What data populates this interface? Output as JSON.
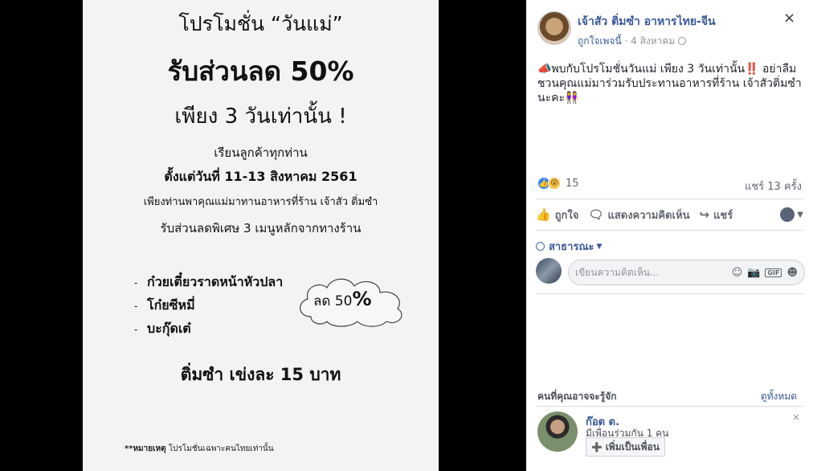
{
  "poster": {
    "promo_title": "โปรโมชั่น “วันแม่”",
    "discount_headline": "รับส่วนลด 50%",
    "only_days": "เพียง 3 วันเท่านั้น !",
    "dear_customers": "เรียนลูกค้าทุกท่าน",
    "date_range": "ตั้งแต่วันที่ 11-13 สิงหาคม 2561",
    "bring_mother": "เพียงท่านพาคุณแม่มาทานอาหารที่ร้าน เจ้าสัว ติ่มซำ",
    "special_discount": "รับส่วนลดพิเศษ 3 เมนูหลักจากทางร้าน",
    "menu_items": [
      "ก๋วยเตี๋ยวราดหน้าหัวปลา",
      "โก๋ยซีหมี่",
      "บะกุ๊ดเต๋"
    ],
    "menu_bullet": "-",
    "cloud_discount": "ลด 50",
    "cloud_percent": "%",
    "dimsum_price": "ติ่มซำ เข่งละ 15 บาท",
    "footnote_label": "**หมายเหตุ",
    "footnote_text": "โปรโมชั่นเฉพาะคนไทยเท่านั้น"
  },
  "post": {
    "page_name": "เจ้าสัว ติ่มซำ อาหารไทย-จีน",
    "like_page_link": "ถูกใจเพจนี้",
    "separator": " · ",
    "date": "4 สิงหาคม",
    "close_icon": "×",
    "text": "📣พบกับโปรโมชั่นวันแม่ เพียง 3 วันเท่านั้น‼️ อย่าลืมชวนคุณแม่มาร่วมรับประทานอาหารที่ร้าน เจ้าสัวติ่มซำนะคะ👭",
    "reaction_count": "15",
    "shares": "แชร์ 13 ครั้ง",
    "actions": {
      "like": "ถูกใจ",
      "comment": "แสดงความคิดเห็น",
      "share": "แชร์"
    },
    "audience": "สาธารณะ",
    "comment_placeholder": "เขียนความคิดเห็น...",
    "gif_label": "GIF"
  },
  "pymk": {
    "title": "คนที่คุณอาจจะรู้จัก",
    "see_all": "ดูทั้งหมด",
    "dismiss": "×",
    "person": {
      "name": "ก๊อต ต.",
      "mutual": "มีเพื่อนร่วมกัน 1 คน",
      "add_button": "เพิ่มเป็นเพื่อน"
    }
  },
  "colors": {
    "link_blue": "#385898",
    "viewer_bg": "#000000"
  }
}
